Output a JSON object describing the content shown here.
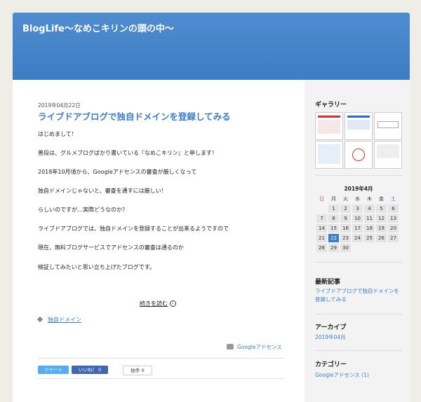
{
  "site": {
    "title": "BlogLife～なめこキリンの頭の中～"
  },
  "post": {
    "date": "2019年04月22日",
    "title": "ライブドアブログで独自ドメインを登録してみる",
    "paragraphs": [
      "はじめまして！",
      "普段は、グルメブログばかり書いている『なめこキリン』と申します！",
      "2018年10月頃から、Googleアドセンスの審査が厳しくなって",
      "独自ドメインじゃないと、審査を通すには厳しい！",
      "らしいのですが…実際どうなのか？",
      "ライブドアブログでは、独自ドメインを登録することが出来るようですので",
      "現在、無料ブログサービスでアドセンスの審査は通るのか",
      "検証してみたいと思い立ち上げたブログです。"
    ],
    "read_more": "続きを読む",
    "tag": "独自ドメイン",
    "category": "Googleアドセンス",
    "share": {
      "tweet": "ツイート",
      "like": "いいね！ 0",
      "clap": "拍手 0"
    }
  },
  "sidebar": {
    "gallery_title": "ギャラリー",
    "calendar": {
      "title": "2019年4月",
      "weekdays": [
        "日",
        "月",
        "火",
        "水",
        "木",
        "金",
        "土"
      ],
      "weeks": [
        [
          "",
          "1",
          "2",
          "3",
          "4",
          "5",
          "6"
        ],
        [
          "7",
          "8",
          "9",
          "10",
          "11",
          "12",
          "13"
        ],
        [
          "14",
          "15",
          "16",
          "17",
          "18",
          "19",
          "20"
        ],
        [
          "21",
          "22",
          "23",
          "24",
          "25",
          "26",
          "27"
        ],
        [
          "28",
          "29",
          "30",
          "",
          "",
          "",
          ""
        ]
      ],
      "today": "22"
    },
    "recent_title": "最新記事",
    "recent_items": [
      "ライブドアブログで独自ドメインを登録してみる"
    ],
    "archive_title": "アーカイブ",
    "archive_items": [
      "2019年04月"
    ],
    "category_title": "カテゴリー",
    "category_items": [
      "Googleアドセンス (1)"
    ]
  }
}
